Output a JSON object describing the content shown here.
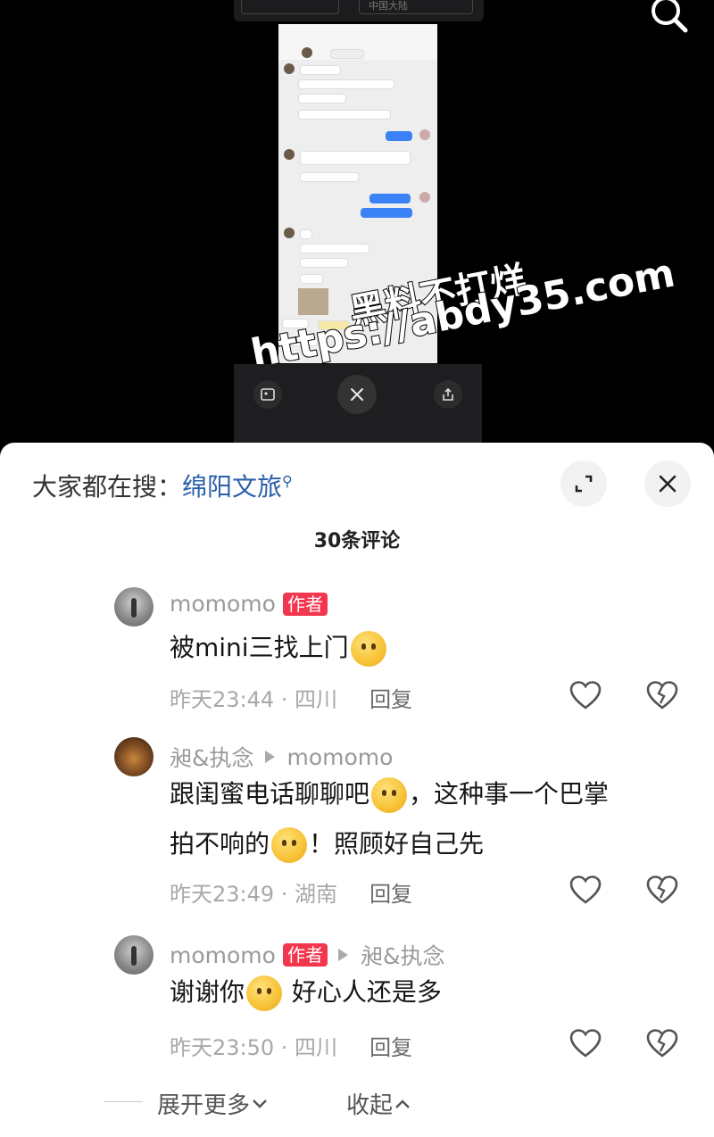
{
  "video": {
    "top_tabs": [
      "中国大陆"
    ],
    "watermark_line1": "黑料不打烊",
    "watermark_line2": "https://abdy35.com"
  },
  "sheet": {
    "trend_prefix": "大家都在搜：",
    "trend_link": "绵阳文旅",
    "comment_count": "30条评论"
  },
  "comments": [
    {
      "user": "momomo",
      "badge": "作者",
      "text_before": "被mini三找上门",
      "emoji": "crying-face",
      "time": "昨天23:44 · 四川",
      "reply": "回复"
    },
    {
      "user": "昶&执念",
      "reply_to": "momomo",
      "text_part1": "跟闺蜜电话聊聊吧",
      "emoji1": "thinking-face",
      "text_part2": "，这种事一个巴掌",
      "text_part3": "拍不响的",
      "emoji2": "dizzy-face",
      "text_part4": "！照顾好自己先",
      "time": "昨天23:49 · 湖南",
      "reply": "回复"
    },
    {
      "user": "momomo",
      "badge": "作者",
      "reply_to": "昶&执念",
      "text_part1": "谢谢你",
      "emoji": "crying-face",
      "text_part2": " 好心人还是多",
      "time": "昨天23:50 · 四川",
      "reply": "回复"
    }
  ],
  "footer": {
    "expand_more": "展开更多",
    "collapse": "收起"
  }
}
